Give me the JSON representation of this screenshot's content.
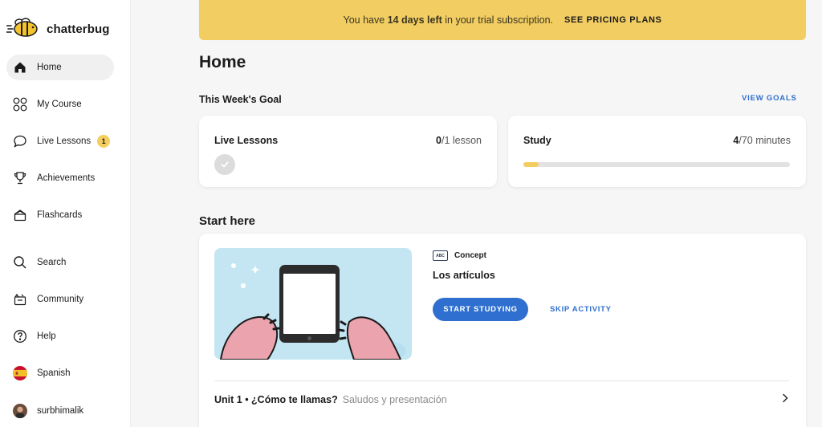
{
  "app": {
    "name": "chatterbug"
  },
  "sidebar": {
    "items": [
      {
        "label": "Home",
        "icon": "home-icon",
        "active": true
      },
      {
        "label": "My Course",
        "icon": "grid-icon"
      },
      {
        "label": "Live Lessons",
        "icon": "chat-bubble-icon",
        "badge": "1"
      },
      {
        "label": "Achievements",
        "icon": "trophy-icon"
      },
      {
        "label": "Flashcards",
        "icon": "flashcards-icon"
      },
      {
        "label": "Search",
        "icon": "search-icon"
      },
      {
        "label": "Community",
        "icon": "community-icon"
      },
      {
        "label": "Help",
        "icon": "help-icon"
      },
      {
        "label": "Spanish",
        "icon": "spain-flag-icon"
      },
      {
        "label": "surbhimalik",
        "icon": "avatar"
      }
    ]
  },
  "banner": {
    "prefix": "You have",
    "days": "14 days left",
    "suffix": "in your trial subscription.",
    "link": "SEE PRICING PLANS"
  },
  "main": {
    "title": "Home",
    "week_goal_heading": "This Week's Goal",
    "view_goals": "VIEW GOALS",
    "goals": [
      {
        "title": "Live Lessons",
        "done": "0",
        "total": "/1 lesson"
      },
      {
        "title": "Study",
        "done": "4",
        "total": "/70 minutes",
        "progress_fraction": 0.057
      }
    ],
    "start_here_heading": "Start here",
    "activity": {
      "type_label": "Concept",
      "type_icon_text": "ABC",
      "title": "Los artículos",
      "start_button": "START STUDYING",
      "skip_button": "SKIP ACTIVITY"
    },
    "unit": {
      "label": "Unit 1 • ¿Cómo te llamas?",
      "subtitle": "Saludos y presentación"
    }
  },
  "colors": {
    "accent_blue": "#2f6fcf",
    "banner_yellow": "#f2cd62",
    "badge_yellow": "#f4cf5f"
  }
}
